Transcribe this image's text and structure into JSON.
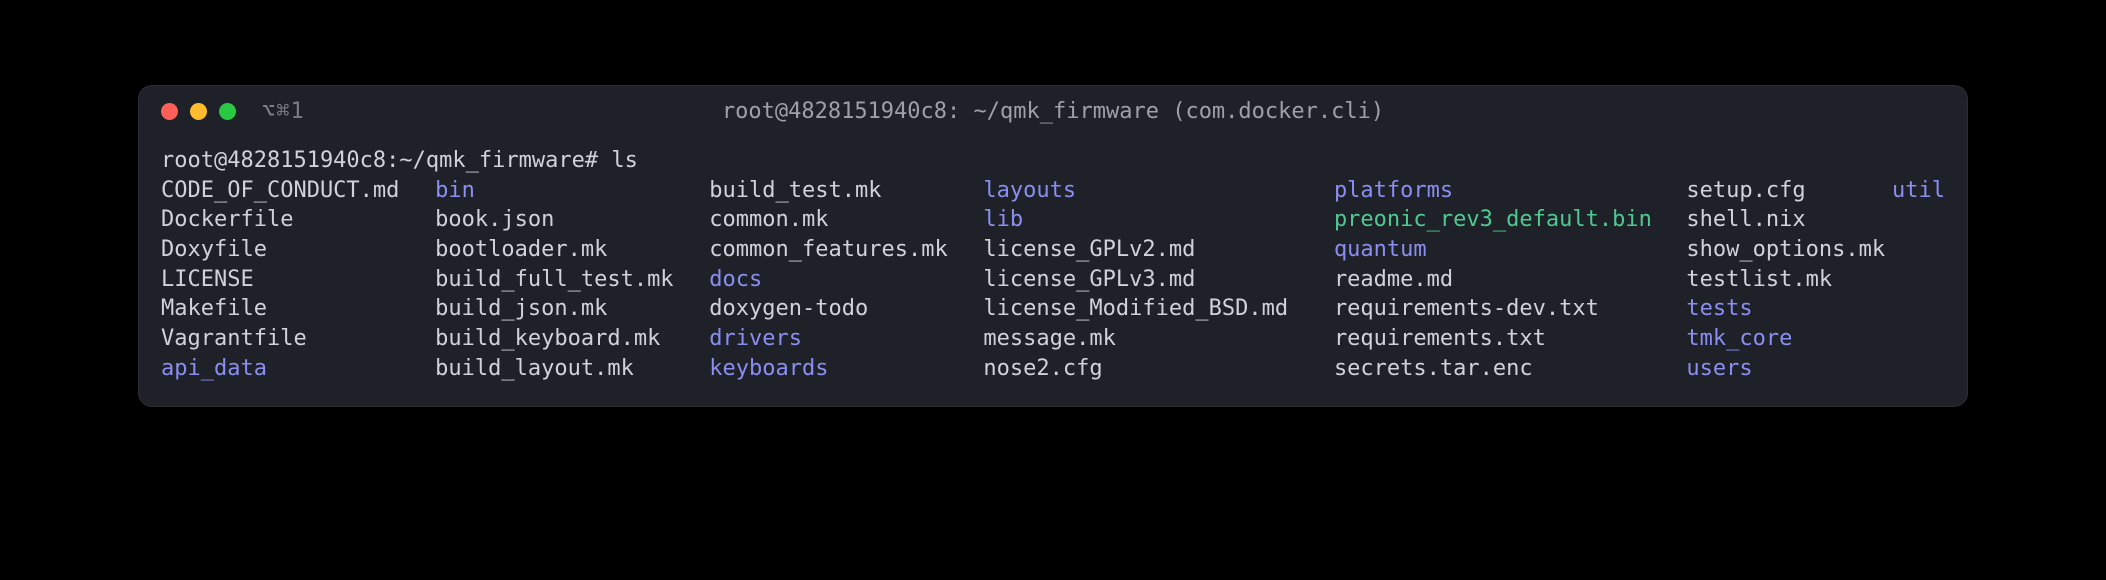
{
  "window": {
    "tab_label": "⌥⌘1",
    "title": "root@4828151940c8: ~/qmk_firmware (com.docker.cli)"
  },
  "prompt": "root@4828151940c8:~/qmk_firmware# ls",
  "listing": {
    "col1": [
      {
        "name": "CODE_OF_CONDUCT.md",
        "type": "file"
      },
      {
        "name": "Dockerfile",
        "type": "file"
      },
      {
        "name": "Doxyfile",
        "type": "file"
      },
      {
        "name": "LICENSE",
        "type": "file"
      },
      {
        "name": "Makefile",
        "type": "file"
      },
      {
        "name": "Vagrantfile",
        "type": "file"
      },
      {
        "name": "api_data",
        "type": "dir"
      }
    ],
    "col2": [
      {
        "name": "bin",
        "type": "dir"
      },
      {
        "name": "book.json",
        "type": "file"
      },
      {
        "name": "bootloader.mk",
        "type": "file"
      },
      {
        "name": "build_full_test.mk",
        "type": "file"
      },
      {
        "name": "build_json.mk",
        "type": "file"
      },
      {
        "name": "build_keyboard.mk",
        "type": "file"
      },
      {
        "name": "build_layout.mk",
        "type": "file"
      }
    ],
    "col3": [
      {
        "name": "build_test.mk",
        "type": "file"
      },
      {
        "name": "common.mk",
        "type": "file"
      },
      {
        "name": "common_features.mk",
        "type": "file"
      },
      {
        "name": "docs",
        "type": "dir"
      },
      {
        "name": "doxygen-todo",
        "type": "file"
      },
      {
        "name": "drivers",
        "type": "dir"
      },
      {
        "name": "keyboards",
        "type": "dir"
      }
    ],
    "col4": [
      {
        "name": "layouts",
        "type": "dir"
      },
      {
        "name": "lib",
        "type": "dir"
      },
      {
        "name": "license_GPLv2.md",
        "type": "file"
      },
      {
        "name": "license_GPLv3.md",
        "type": "file"
      },
      {
        "name": "license_Modified_BSD.md",
        "type": "file"
      },
      {
        "name": "message.mk",
        "type": "file"
      },
      {
        "name": "nose2.cfg",
        "type": "file"
      }
    ],
    "col5": [
      {
        "name": "platforms",
        "type": "dir"
      },
      {
        "name": "preonic_rev3_default.bin",
        "type": "exec"
      },
      {
        "name": "quantum",
        "type": "dir"
      },
      {
        "name": "readme.md",
        "type": "file"
      },
      {
        "name": "requirements-dev.txt",
        "type": "file"
      },
      {
        "name": "requirements.txt",
        "type": "file"
      },
      {
        "name": "secrets.tar.enc",
        "type": "file"
      }
    ],
    "col6": [
      {
        "name": "setup.cfg",
        "type": "file"
      },
      {
        "name": "shell.nix",
        "type": "file"
      },
      {
        "name": "show_options.mk",
        "type": "file"
      },
      {
        "name": "testlist.mk",
        "type": "file"
      },
      {
        "name": "tests",
        "type": "dir"
      },
      {
        "name": "tmk_core",
        "type": "dir"
      },
      {
        "name": "users",
        "type": "dir"
      }
    ],
    "col7": [
      {
        "name": "util",
        "type": "dir"
      }
    ]
  }
}
